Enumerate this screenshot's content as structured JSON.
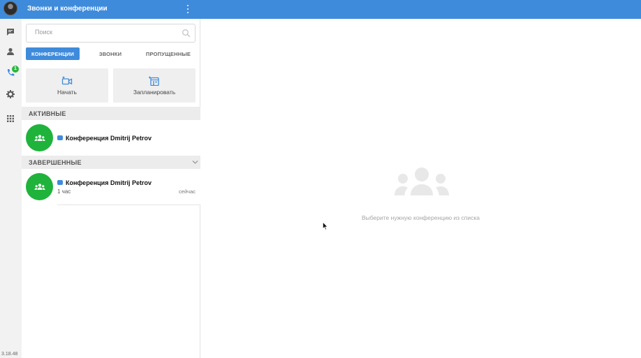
{
  "app": {
    "version": "3.18.48"
  },
  "rail": {
    "items": [
      {
        "icon": "chat-icon",
        "badge": ""
      },
      {
        "icon": "contact-icon",
        "badge": ""
      },
      {
        "icon": "phone-icon",
        "badge": "1"
      },
      {
        "icon": "gear-icon",
        "badge": ""
      },
      {
        "icon": "apps-grid-icon",
        "badge": ""
      }
    ]
  },
  "panel": {
    "title": "Звонки и конференции",
    "search": {
      "placeholder": "Поиск",
      "value": ""
    },
    "tabs": [
      {
        "label": "КОНФЕРЕНЦИИ",
        "active": true
      },
      {
        "label": "ЗВОНКИ",
        "active": false
      },
      {
        "label": "ПРОПУЩЕННЫЕ",
        "active": false
      }
    ],
    "actions": [
      {
        "label": "Начать",
        "icon": "video-add-icon"
      },
      {
        "label": "Запланировать",
        "icon": "calendar-add-icon"
      }
    ],
    "active_section": {
      "title": "АКТИВНЫЕ",
      "items": [
        {
          "name": "Конференция Dmitrij Petrov"
        }
      ]
    },
    "finished_section": {
      "title": "ЗАВЕРШЕННЫЕ",
      "items": [
        {
          "name": "Конференция Dmitrij Petrov",
          "duration": "1 час",
          "time": "сейчас"
        }
      ]
    }
  },
  "main": {
    "empty_text": "Выберите нужную конференцию из списка"
  },
  "colors": {
    "accent": "#3f8bdb",
    "conference_avatar": "#1fb33c",
    "badge": "#2bb53c"
  }
}
